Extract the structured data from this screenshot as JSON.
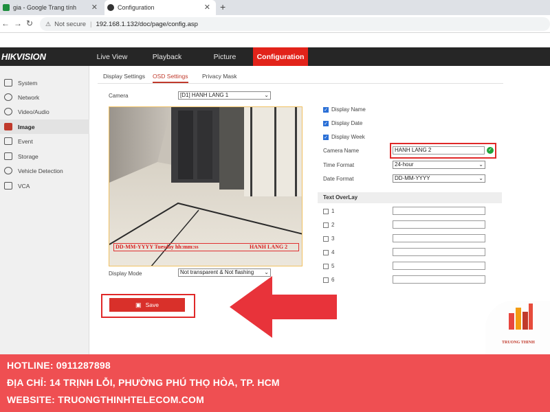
{
  "browser": {
    "tabs": [
      {
        "title": "gia - Google Trang tính"
      },
      {
        "title": "Configuration"
      }
    ],
    "not_secure": "Not secure",
    "url": "192.168.1.132/doc/page/config.asp"
  },
  "app": {
    "logo": "HIKVISION",
    "nav": [
      "Live View",
      "Playback",
      "Picture",
      "Configuration"
    ]
  },
  "sidebar": {
    "items": [
      {
        "label": "System",
        "icon": "monitor-icon"
      },
      {
        "label": "Network",
        "icon": "globe-icon"
      },
      {
        "label": "Video/Audio",
        "icon": "video-audio-icon"
      },
      {
        "label": "Image",
        "icon": "image-icon"
      },
      {
        "label": "Event",
        "icon": "event-icon"
      },
      {
        "label": "Storage",
        "icon": "storage-icon"
      },
      {
        "label": "Vehicle Detection",
        "icon": "vehicle-icon"
      },
      {
        "label": "VCA",
        "icon": "vca-icon"
      }
    ]
  },
  "subtabs": [
    "Display Settings",
    "OSD Settings",
    "Privacy Mask"
  ],
  "form": {
    "camera_label": "Camera",
    "camera_value": "[D1] HANH LANG 1",
    "display_mode_label": "Display Mode",
    "display_mode_value": "Not transparent & Not flashing",
    "checks": [
      {
        "label": "Display Name",
        "checked": true
      },
      {
        "label": "Display Date",
        "checked": true
      },
      {
        "label": "Display Week",
        "checked": true
      }
    ],
    "camera_name_label": "Camera Name",
    "camera_name_value": "HANH LANG 2",
    "time_format_label": "Time Format",
    "time_format_value": "24-hour",
    "date_format_label": "Date Format",
    "date_format_value": "DD-MM-YYYY",
    "text_overlay_title": "Text OverLay",
    "overlay_items": [
      "1",
      "2",
      "3",
      "4",
      "5",
      "6"
    ],
    "save_label": "Save"
  },
  "video": {
    "osd_left": "DD-MM-YYYY Tuesday hh:mm:ss",
    "osd_right": "HANH LANG 2"
  },
  "watermark": {
    "brand": "TRUONG THINH"
  },
  "footer": {
    "hotline": "HOTLINE: 0911287898",
    "address": "ĐỊA CHỈ: 14 TRỊNH LỖI, PHƯỜNG PHÚ THỌ HÒA, TP. HCM",
    "website": "WEBSITE: TRUONGTHINHTELECOM.COM"
  },
  "colors": {
    "accent": "#e2231a",
    "footer": "#ef4f52",
    "highlight": "#e02828",
    "ok": "#1fa33a"
  }
}
